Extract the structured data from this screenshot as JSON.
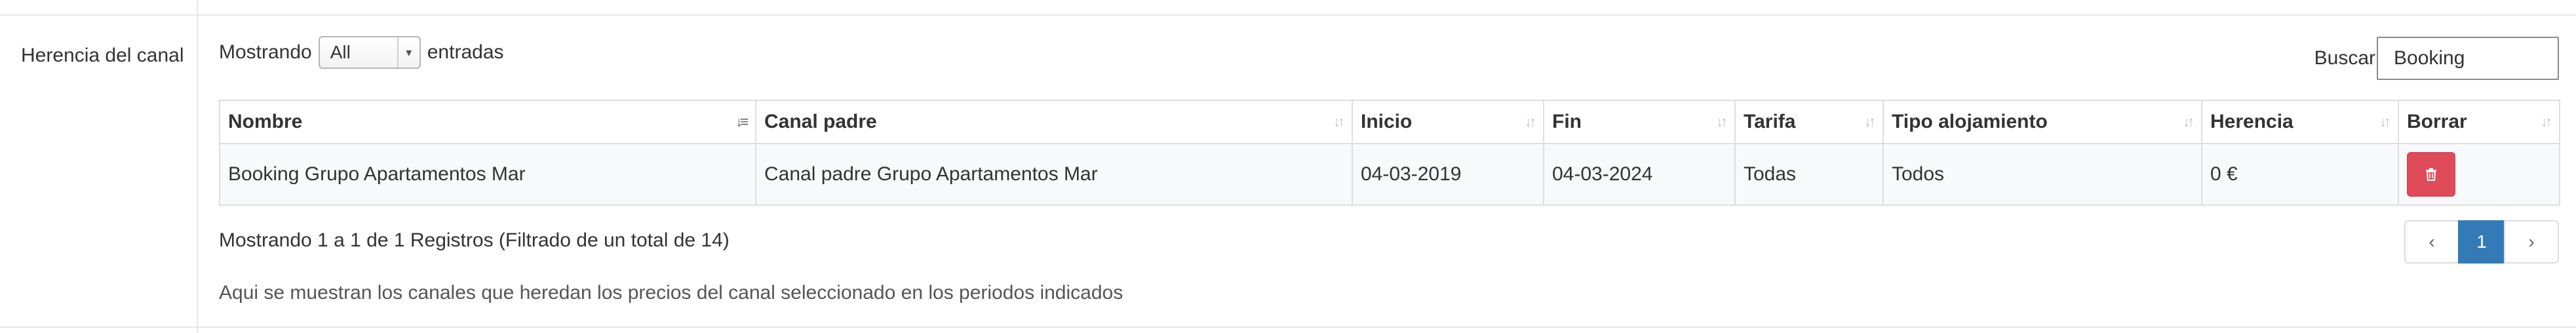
{
  "section": {
    "label": "Herencia del canal"
  },
  "length_control": {
    "prefix": "Mostrando",
    "selected": "All",
    "suffix": "entradas"
  },
  "search": {
    "label": "Buscar",
    "value": "Booking"
  },
  "table": {
    "columns": [
      "Nombre",
      "Canal padre",
      "Inicio",
      "Fin",
      "Tarifa",
      "Tipo alojamiento",
      "Herencia",
      "Borrar"
    ],
    "sorted_column": "Nombre",
    "rows": [
      {
        "nombre": "Booking Grupo Apartamentos Mar",
        "canal_padre": "Canal padre Grupo Apartamentos Mar",
        "inicio": "04-03-2019",
        "fin": "04-03-2024",
        "tarifa": "Todas",
        "tipo_alojamiento": "Todos",
        "herencia": "0 €"
      }
    ]
  },
  "info": "Mostrando 1 a 1 de 1 Registros (Filtrado de un total de 14)",
  "pagination": {
    "prev": "‹",
    "current": "1",
    "next": "›"
  },
  "note": "Aqui se muestran los canales que heredan los precios del canal seleccionado en los periodos indicados",
  "colors": {
    "danger": "#e04b59",
    "primary": "#337ab7",
    "border": "#dedede"
  },
  "icons": {
    "delete": "trash-icon",
    "sort": "sort-arrows-icon"
  }
}
